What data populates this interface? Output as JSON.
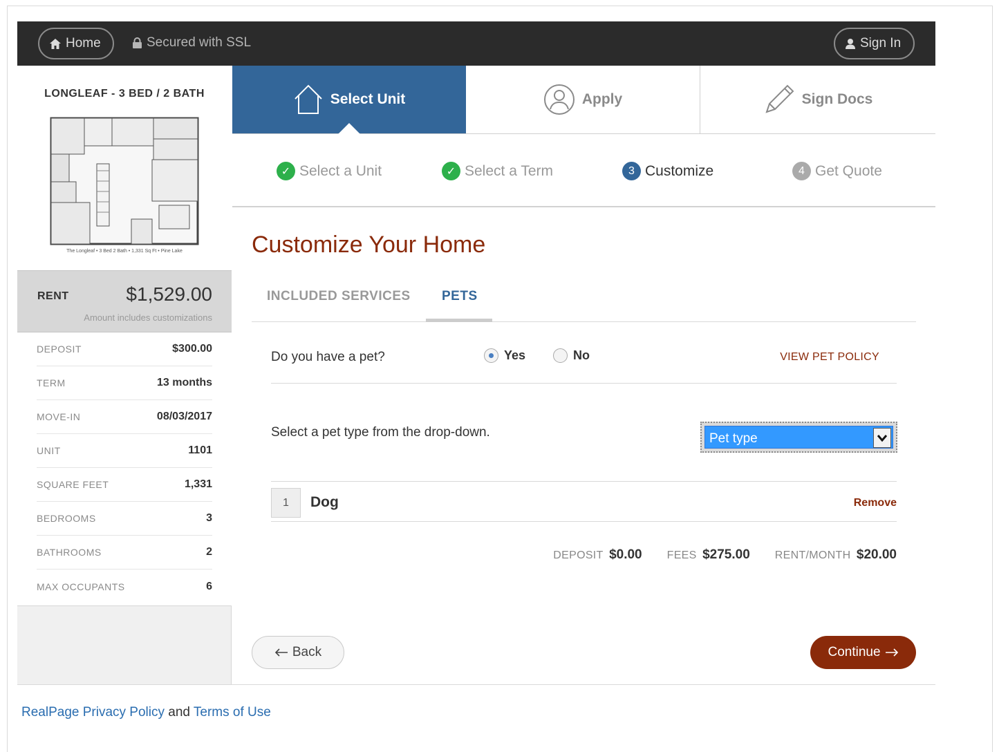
{
  "topbar": {
    "home_label": "Home",
    "ssl_label": "Secured with SSL",
    "signin_label": "Sign In"
  },
  "sidebar": {
    "unit_name": "LONGLEAF - 3 BED / 2 BATH",
    "floorplan_caption": "The Longleaf • 3 Bed 2 Bath • 1,331 Sq Ft • Pine Lake",
    "rent_label": "RENT",
    "rent_value": "$1,529.00",
    "rent_note": "Amount includes customizations",
    "details": [
      {
        "label": "DEPOSIT",
        "value": "$300.00"
      },
      {
        "label": "TERM",
        "value": "13 months"
      },
      {
        "label": "MOVE-IN",
        "value": "08/03/2017"
      },
      {
        "label": "UNIT",
        "value": "1101"
      },
      {
        "label": "SQUARE FEET",
        "value": "1,331"
      },
      {
        "label": "BEDROOMS",
        "value": "3"
      },
      {
        "label": "BATHROOMS",
        "value": "2"
      },
      {
        "label": "MAX OCCUPANTS",
        "value": "6"
      }
    ]
  },
  "steps": [
    {
      "label": "Select Unit",
      "icon": "house-icon"
    },
    {
      "label": "Apply",
      "icon": "user-circle-icon"
    },
    {
      "label": "Sign Docs",
      "icon": "pencil-icon"
    }
  ],
  "substeps": [
    {
      "label": "Select a Unit",
      "marker": "✓"
    },
    {
      "label": "Select a Term",
      "marker": "✓"
    },
    {
      "label": "Customize",
      "marker": "3"
    },
    {
      "label": "Get Quote",
      "marker": "4"
    }
  ],
  "main": {
    "heading": "Customize Your Home",
    "tabs": [
      "INCLUDED SERVICES",
      "PETS"
    ],
    "pet_question": "Do you have a pet?",
    "radio_yes": "Yes",
    "radio_no": "No",
    "pet_policy_link": "VIEW PET POLICY",
    "pet_select_label": "Select a pet type from the drop-down.",
    "pet_select_value": "Pet type",
    "pet_item_index": "1",
    "pet_item_name": "Dog",
    "remove_label": "Remove",
    "totals": [
      {
        "label": "DEPOSIT",
        "value": "$0.00"
      },
      {
        "label": "FEES",
        "value": "$275.00"
      },
      {
        "label": "RENT/MONTH",
        "value": "$20.00"
      }
    ],
    "back_label": "Back",
    "continue_label": "Continue"
  },
  "footer": {
    "privacy_link": "RealPage Privacy Policy",
    "and_text": "and",
    "terms_link": "Terms of Use"
  },
  "colors": {
    "accent_blue": "#336699",
    "brand_red": "#8a2a0a",
    "success_green": "#2db04b",
    "topbar_dark": "#2b2b2b"
  }
}
